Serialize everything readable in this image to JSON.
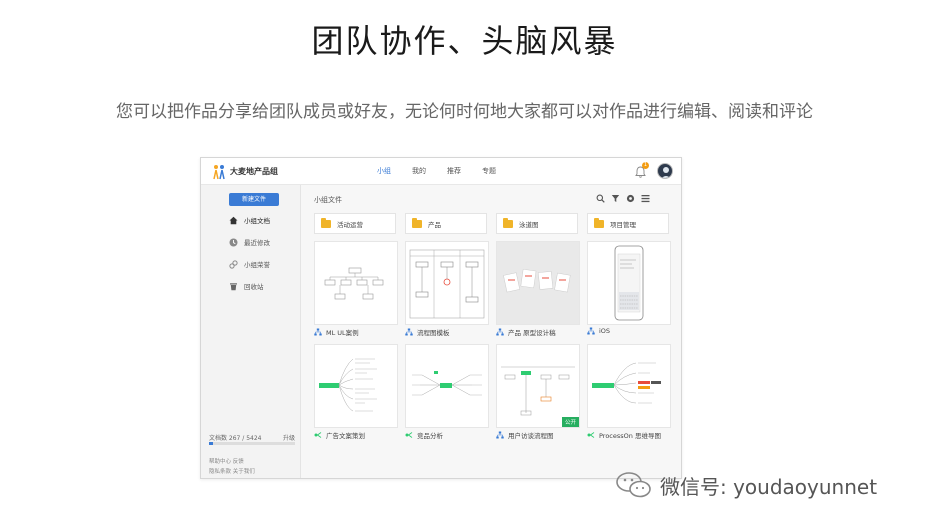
{
  "headline": "团队协作、头脑风暴",
  "subline": "您可以把作品分享给团队成员或好友，无论何时何地大家都可以对作品进行编辑、阅读和评论",
  "app": {
    "title": "大麦地产品组",
    "nav": [
      "小组",
      "我的",
      "推荐",
      "专题"
    ],
    "notification_count": "1",
    "sidebar": {
      "new_button": "新建文件",
      "items": [
        "小组文档",
        "最近修改",
        "小组荣誉",
        "回收站"
      ],
      "quota_label": "文档数 267 / 5424",
      "quota_upgrade": "升级",
      "quota_fraction": 0.05,
      "footer_line1": "帮助中心  反馈",
      "footer_line2": "隐私条款  关于我们"
    },
    "content_title": "小组文件",
    "folders": [
      "活动运营",
      "产品",
      "泳道图",
      "项目管理"
    ],
    "cards": [
      {
        "label": "ML UL案例",
        "type": "flowchart"
      },
      {
        "label": "流程图模板",
        "type": "flowchart"
      },
      {
        "label": "产品 原型设计稿",
        "type": "flowchart"
      },
      {
        "label": "iOS",
        "type": "flowchart"
      },
      {
        "label": "广告文案策划",
        "type": "mindmap"
      },
      {
        "label": "竞品分析",
        "type": "mindmap"
      },
      {
        "label": "用户访谈流程图",
        "type": "flowchart",
        "badge": "公开"
      },
      {
        "label": "ProcessOn 思维导图",
        "type": "mindmap"
      }
    ]
  },
  "watermark": "微信号: youdaoyunnet",
  "colors": {
    "accent": "#3a7bd5",
    "folder": "#f0b429",
    "mindmap": "#2ecc71",
    "badge": "#27ae60"
  }
}
